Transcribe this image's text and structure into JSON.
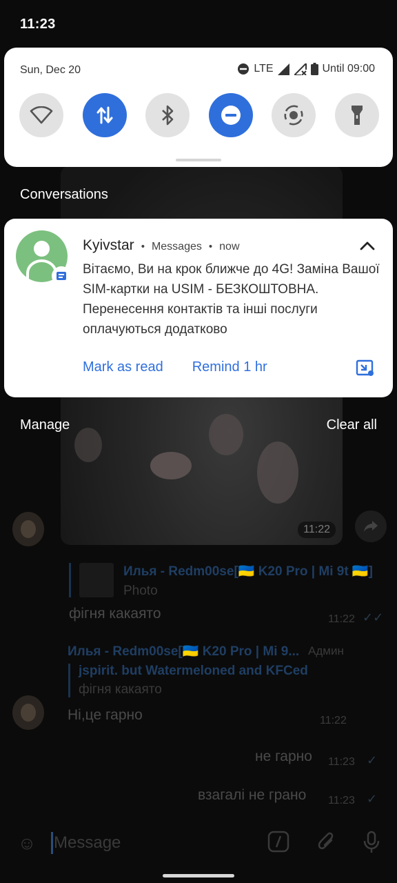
{
  "status_bar": {
    "time": "11:23"
  },
  "quick_settings": {
    "date": "Sun, Dec 20",
    "network": "LTE",
    "battery": "Until 09:00",
    "tiles": [
      {
        "name": "wifi-tile",
        "icon": "wifi-icon",
        "on": false
      },
      {
        "name": "mobile-data-tile",
        "icon": "data-arrows-icon",
        "on": true
      },
      {
        "name": "bluetooth-tile",
        "icon": "bluetooth-icon",
        "on": false
      },
      {
        "name": "dnd-tile",
        "icon": "do-not-disturb-icon",
        "on": true
      },
      {
        "name": "auto-rotate-tile",
        "icon": "rotate-icon",
        "on": false
      },
      {
        "name": "flashlight-tile",
        "icon": "flashlight-icon",
        "on": false
      }
    ]
  },
  "shade": {
    "section_title": "Conversations",
    "manage_label": "Manage",
    "clear_all_label": "Clear all"
  },
  "notification": {
    "sender": "Kyivstar",
    "app": "Messages",
    "when": "now",
    "body": "Вітаємо, Ви на крок ближче до 4G! Заміна Вашої SIM-картки на USIM - БЕЗКОШТОВНА. Перенесення контактів та інші послуги оплачуються додатково",
    "actions": [
      "Mark as read",
      "Remind 1 hr"
    ],
    "accent": "#2f6fdc"
  },
  "chat": {
    "photo_time": "11:22",
    "reply_author": "Илья - Redm00se[🇺🇦 K20 Pro | Mi 9t 🇺🇦]",
    "reply_sub": "Photo",
    "msg1_text": "фігня какаято",
    "msg1_time": "11:22",
    "author2": "Илья - Redm00se[🇺🇦 K20 Pro | Mi 9...",
    "author2_role": "Админ",
    "quote_author": "jspirit. but Watermeloned and KFCed",
    "quote_text": "фігня какаято",
    "msg2_text": "Ні,це гарно",
    "msg2_time": "11:22",
    "msg3_text": "не гарно",
    "msg3_time": "11:23",
    "msg4_text": "взагалі не грано",
    "msg4_time": "11:23",
    "input_placeholder": "Message"
  }
}
